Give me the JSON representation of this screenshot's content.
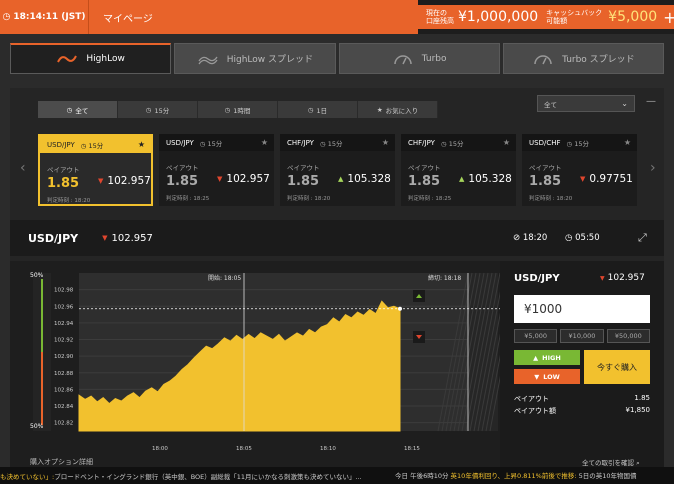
{
  "topbar": {
    "time": "18:14:11 (JST)",
    "mypage": "マイページ",
    "balance_label": "現在の\n口座残高",
    "balance": "¥1,000,000",
    "cashback_label": "キャッシュバック\n可能額",
    "cashback": "¥5,000",
    "plus": "+"
  },
  "main_tabs": [
    {
      "label": "HighLow"
    },
    {
      "label": "HighLow スプレッド"
    },
    {
      "label": "Turbo"
    },
    {
      "label": "Turbo スプレッド"
    }
  ],
  "filter_tabs": [
    {
      "label": "全て"
    },
    {
      "label": "15分"
    },
    {
      "label": "1時間"
    },
    {
      "label": "1日"
    },
    {
      "label": "お気に入り"
    }
  ],
  "select": {
    "value": "全て"
  },
  "cards": [
    {
      "symbol": "USD/JPY",
      "duration": "15分",
      "payout_label": "ペイアウト",
      "payout": "1.85",
      "rate": "102.957",
      "direction": "down",
      "judge": "判定時刻 : 18:20"
    },
    {
      "symbol": "USD/JPY",
      "duration": "15分",
      "payout_label": "ペイアウト",
      "payout": "1.85",
      "rate": "102.957",
      "direction": "down",
      "judge": "判定時刻 : 18:25"
    },
    {
      "symbol": "CHF/JPY",
      "duration": "15分",
      "payout_label": "ペイアウト",
      "payout": "1.85",
      "rate": "105.328",
      "direction": "up",
      "judge": "判定時刻 : 18:20"
    },
    {
      "symbol": "CHF/JPY",
      "duration": "15分",
      "payout_label": "ペイアウト",
      "payout": "1.85",
      "rate": "105.328",
      "direction": "up",
      "judge": "判定時刻 : 18:25"
    },
    {
      "symbol": "USD/CHF",
      "duration": "15分",
      "payout_label": "ペイアウト",
      "payout": "1.85",
      "rate": "0.97751",
      "direction": "down",
      "judge": "判定時刻 : 18:20"
    }
  ],
  "asset": {
    "symbol": "USD/JPY",
    "rate": "102.957",
    "judge_time": "18:20",
    "remaining": "05:50"
  },
  "chart_data": {
    "type": "area",
    "open_label": "開始: 18:05",
    "close_label": "締切: 18:18",
    "pct_top": "50%",
    "pct_bottom": "50%",
    "y_ticks": [
      "102.98",
      "102.96",
      "102.94",
      "102.92",
      "102.90",
      "102.88",
      "102.86",
      "102.84",
      "102.82"
    ],
    "x_ticks": [
      "18:00",
      "18:05",
      "18:10",
      "18:15"
    ],
    "ylim": [
      102.81,
      103.0
    ],
    "current_value": 102.957,
    "y": [
      102.853,
      102.848,
      102.852,
      102.845,
      102.85,
      102.843,
      102.849,
      102.846,
      102.852,
      102.856,
      102.85,
      102.858,
      102.862,
      102.857,
      102.866,
      102.87,
      102.876,
      102.884,
      102.89,
      102.898,
      102.905,
      102.912,
      102.909,
      102.915,
      102.922,
      102.918,
      102.925,
      102.92,
      102.926,
      102.921,
      102.928,
      102.924,
      102.92,
      102.926,
      102.918,
      102.923,
      102.928,
      102.924,
      102.932,
      102.928,
      102.935,
      102.938,
      102.946,
      102.941,
      102.95,
      102.946,
      102.953,
      102.949,
      102.956,
      102.951,
      102.966,
      102.958,
      102.96,
      102.957
    ]
  },
  "order": {
    "symbol": "USD/JPY",
    "rate": "102.957",
    "amount": "¥1000",
    "presets": [
      "¥5,000",
      "¥10,000",
      "¥50,000"
    ],
    "high": "HIGH",
    "low": "LOW",
    "buy": "今すぐ購入",
    "payout_label": "ペイアウト",
    "payout": "1.85",
    "payout_amount_label": "ペイアウト額",
    "payout_amount": "¥1,850"
  },
  "footer": {
    "detail": "購入オプション詳細",
    "all_tx": "全ての取引を確認",
    "ticker_left": "も決めていない」:",
    "ticker_mid": " ブロードベント・イングランド銀行（英中銀、BOE）副総裁「11月にいかなる刺激策も決めていない」...",
    "ticker_time": "今日 午後6時10分 ",
    "ticker_hl": "英10年債利回り、上昇0.811%前後で推移:",
    "ticker_tail": " 5日の英10年物国債"
  },
  "colors": {
    "accent": "#e8632a",
    "gold": "#f2c12e",
    "up": "#79b834",
    "down": "#e0462e"
  }
}
